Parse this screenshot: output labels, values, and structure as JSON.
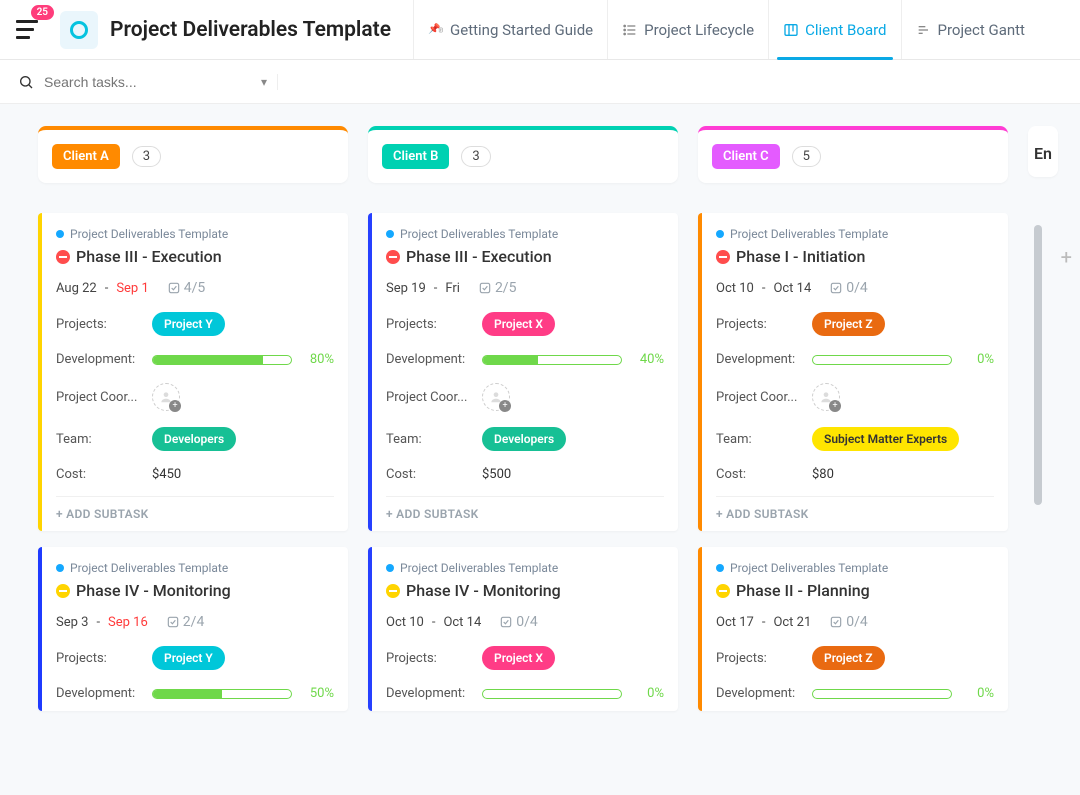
{
  "header": {
    "badge": "25",
    "title": "Project Deliverables Template",
    "tabs": [
      {
        "label": "Getting Started Guide"
      },
      {
        "label": "Project Lifecycle"
      },
      {
        "label": "Client Board"
      },
      {
        "label": "Project Gantt"
      }
    ]
  },
  "search": {
    "placeholder": "Search tasks..."
  },
  "columns": [
    {
      "label": "Client A",
      "count": "3"
    },
    {
      "label": "Client B",
      "count": "3"
    },
    {
      "label": "Client C",
      "count": "5"
    },
    {
      "label": "En"
    }
  ],
  "template_name": "Project Deliverables Template",
  "add_subtask": "+ ADD SUBTASK",
  "labels": {
    "projects": "Projects:",
    "development": "Development:",
    "coord": "Project Coor...",
    "team": "Team:",
    "cost": "Cost:"
  },
  "cards": {
    "a1": {
      "phase": "Phase III - Execution",
      "dates_a": "Aug 22",
      "sep": "-",
      "dates_b": "Sep 1",
      "check": "4/5",
      "project": "Project Y",
      "pct": "80%",
      "team": "Developers",
      "cost": "$450",
      "dev_fill": 80
    },
    "a2": {
      "phase": "Phase IV - Monitoring",
      "dates_a": "Sep 3",
      "sep": "-",
      "dates_b": "Sep 16",
      "check": "2/4",
      "project": "Project Y",
      "pct": "50%",
      "dev_fill": 50
    },
    "b1": {
      "phase": "Phase III - Execution",
      "dates_a": "Sep 19",
      "sep": "-",
      "dates_b": "Fri",
      "check": "2/5",
      "project": "Project X",
      "pct": "40%",
      "team": "Developers",
      "cost": "$500",
      "dev_fill": 40
    },
    "b2": {
      "phase": "Phase IV - Monitoring",
      "dates_a": "Oct 10",
      "sep": "-",
      "dates_b": "Oct 14",
      "check": "0/4",
      "project": "Project X",
      "pct": "0%",
      "dev_fill": 0
    },
    "c1": {
      "phase": "Phase I - Initiation",
      "dates_a": "Oct 10",
      "sep": "-",
      "dates_b": "Oct 14",
      "check": "0/4",
      "project": "Project Z",
      "pct": "0%",
      "team": "Subject Matter Experts",
      "cost": "$80",
      "dev_fill": 0
    },
    "c2": {
      "phase": "Phase II - Planning",
      "dates_a": "Oct 17",
      "sep": "-",
      "dates_b": "Oct 21",
      "check": "0/4",
      "project": "Project Z",
      "pct": "0%",
      "dev_fill": 0
    }
  }
}
